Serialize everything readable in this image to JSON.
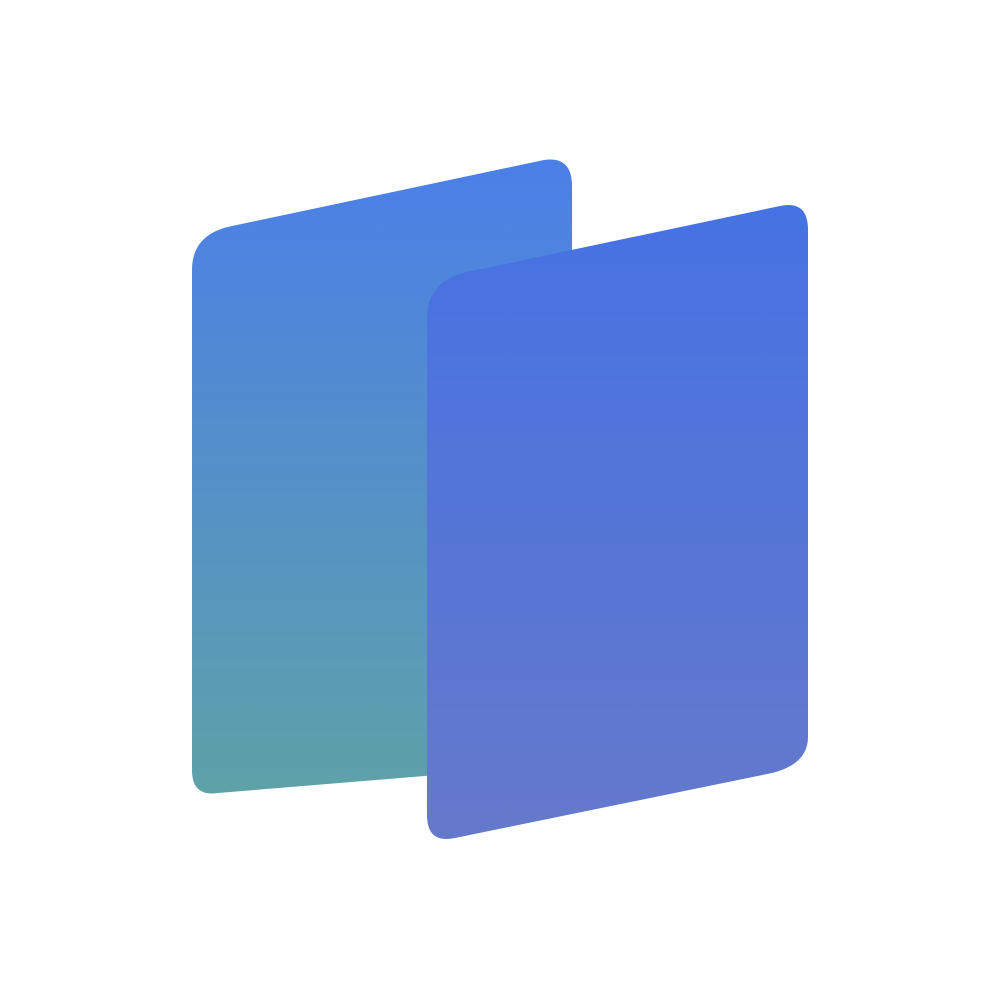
{
  "background": "#ffffff",
  "logo": {
    "icon": "two-parallelogram-cards-logo",
    "back_card": {
      "gradient_top": "#4b7fe8",
      "gradient_bottom": "#5ea2a8"
    },
    "front_card": {
      "gradient_top": "#4672e3",
      "gradient_bottom": "#6579cb"
    }
  }
}
